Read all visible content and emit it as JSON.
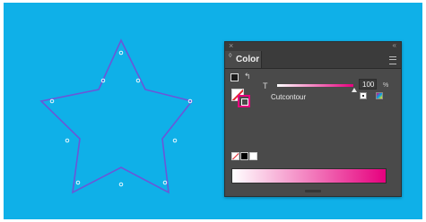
{
  "panel": {
    "close_glyph": "×",
    "collapse_glyph": "«",
    "tab_arrows_glyph": "◊",
    "title": "Color",
    "swap_glyph": "↰",
    "tint_label": "T",
    "tint_value": "100",
    "tint_unit": "%",
    "swatch_name": "Cutcontour",
    "tint_fraction": 1.0
  },
  "colors": {
    "canvas_bg": "#0fb0e8",
    "star_stroke": "#6a57d8",
    "anchor_points": "#ffffff",
    "swatch_color": "#e6007e",
    "panel_bg": "#4a4a4a"
  },
  "icons": [
    "close-icon",
    "collapse-icon",
    "panel-menu-icon",
    "swap-fill-stroke-icon",
    "fill-icon",
    "stroke-icon",
    "swatch-mode-icon",
    "color-mode-icon",
    "none-color-icon"
  ]
}
